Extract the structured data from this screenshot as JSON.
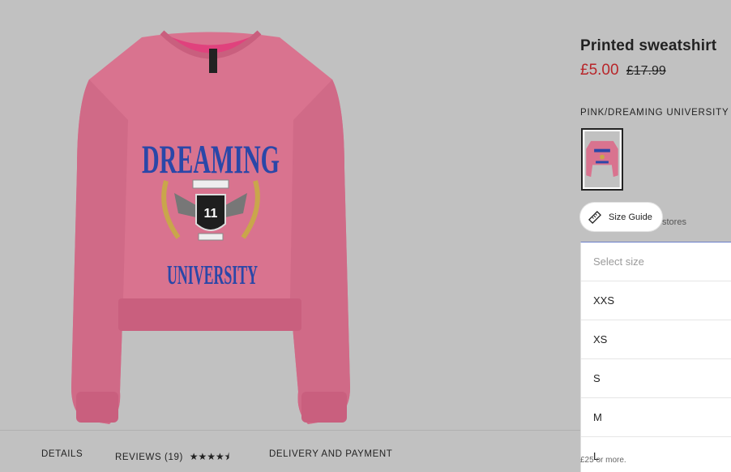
{
  "product": {
    "title": "Printed sweatshirt",
    "price_sale": "£5.00",
    "price_original": "£17.99",
    "color_label": "PINK/DREAMING UNIVERSITY",
    "print_top": "DREAMING",
    "print_bottom": "UNIVERSITY",
    "print_number": "11",
    "neck_label": "DIVIDED",
    "accent_color": "#b8262a",
    "garment_color": "#d9738f"
  },
  "size_guide": {
    "label": "Size Guide",
    "stores_text": "stores"
  },
  "size_select": {
    "placeholder": "Select size",
    "options": [
      "XXS",
      "XS",
      "S",
      "M",
      "L"
    ]
  },
  "tabs": {
    "details": "DETAILS",
    "reviews": "REVIEWS (19)",
    "reviews_stars": "★★★★⯨",
    "delivery": "DELIVERY AND PAYMENT"
  },
  "footer_cutoff": "£25 or more."
}
